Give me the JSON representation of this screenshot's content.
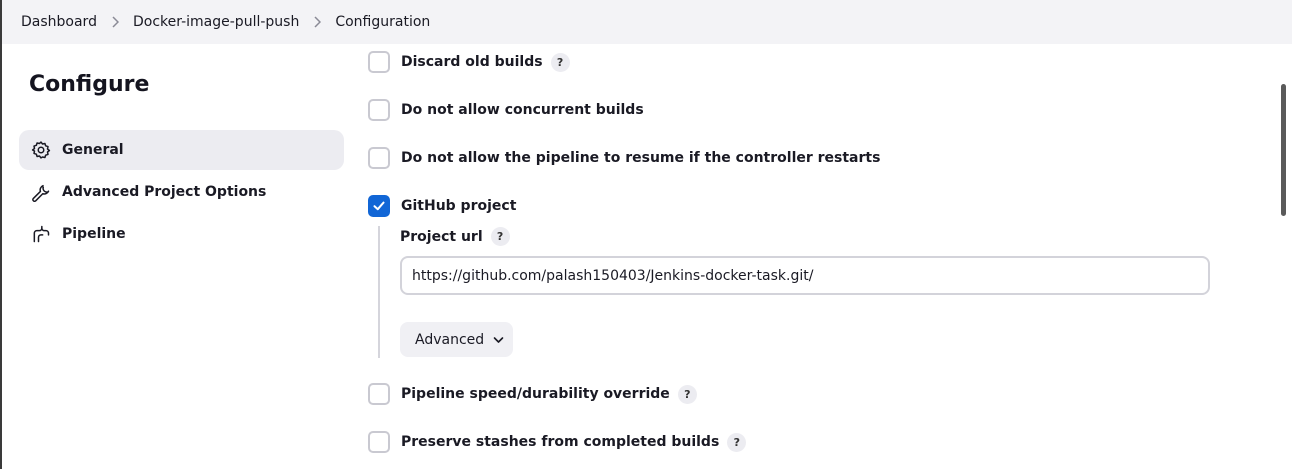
{
  "breadcrumb": {
    "items": [
      "Dashboard",
      "Docker-image-pull-push",
      "Configuration"
    ]
  },
  "sidebar": {
    "title": "Configure",
    "items": [
      {
        "label": "General",
        "icon": "gear-icon"
      },
      {
        "label": "Advanced Project Options",
        "icon": "wrench-icon"
      },
      {
        "label": "Pipeline",
        "icon": "pipeline-icon"
      }
    ]
  },
  "options": [
    {
      "label": "Discard old builds",
      "checked": false,
      "help": "?"
    },
    {
      "label": "Do not allow concurrent builds",
      "checked": false
    },
    {
      "label": "Do not allow the pipeline to resume if the controller restarts",
      "checked": false
    },
    {
      "label": "GitHub project",
      "checked": true
    },
    {
      "label": "Pipeline speed/durability override",
      "checked": false,
      "help": "?"
    },
    {
      "label": "Preserve stashes from completed builds",
      "checked": false,
      "help": "?"
    }
  ],
  "github": {
    "project_url_label": "Project url",
    "help": "?",
    "project_url_value": "https://github.com/palash150403/Jenkins-docker-task.git/",
    "advanced_label": "Advanced"
  },
  "colors": {
    "accent": "#1166d6",
    "active_bg": "#ececf1"
  }
}
